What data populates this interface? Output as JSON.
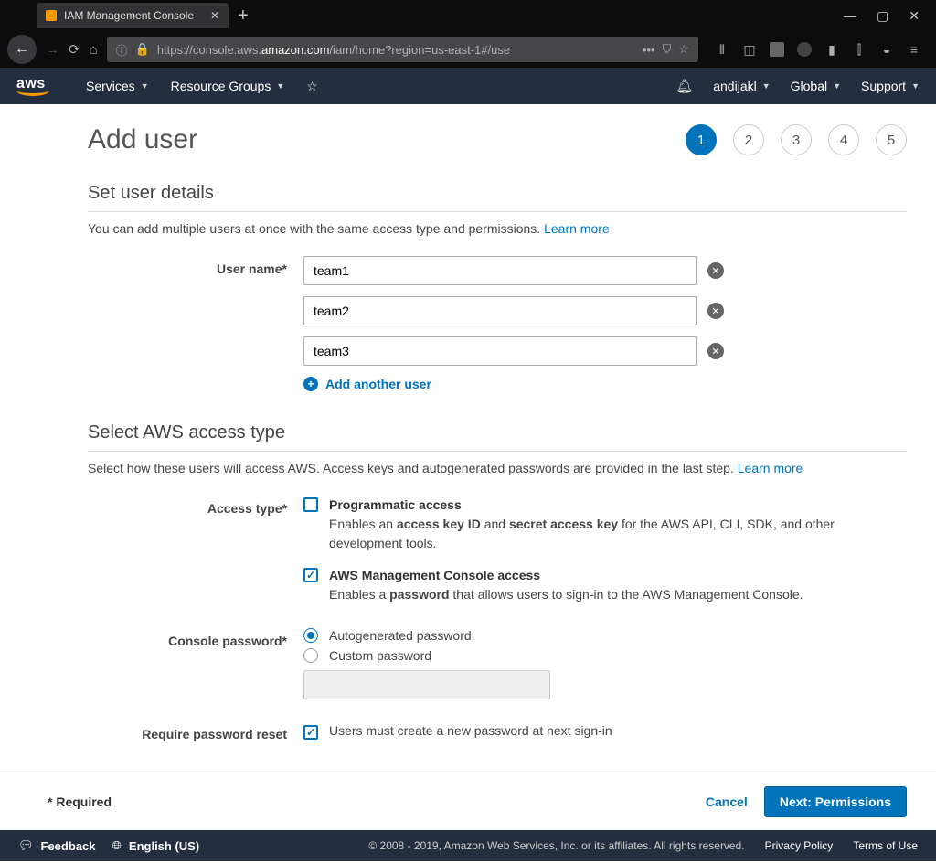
{
  "browser": {
    "tab_title": "IAM Management Console",
    "url_pre": "https://console.aws.",
    "url_dom": "amazon.com",
    "url_post": "/iam/home?region=us-east-1#/use"
  },
  "nav": {
    "logo": "aws",
    "services": "Services",
    "resource_groups": "Resource Groups",
    "user": "andijakl",
    "region": "Global",
    "support": "Support"
  },
  "page": {
    "title": "Add user",
    "steps": [
      "1",
      "2",
      "3",
      "4",
      "5"
    ],
    "active_step": 0
  },
  "details": {
    "heading": "Set user details",
    "desc": "You can add multiple users at once with the same access type and permissions. ",
    "learn": "Learn more",
    "username_label": "User name*",
    "users": [
      "team1",
      "team2",
      "team3"
    ],
    "add_another": "Add another user"
  },
  "access": {
    "heading": "Select AWS access type",
    "desc": "Select how these users will access AWS. Access keys and autogenerated passwords are provided in the last step. ",
    "learn": "Learn more",
    "type_label": "Access type*",
    "prog_title": "Programmatic access",
    "prog_pre": "Enables an ",
    "prog_b1": "access key ID",
    "prog_mid": " and ",
    "prog_b2": "secret access key",
    "prog_post": " for the AWS API, CLI, SDK, and other development tools.",
    "cons_title": "AWS Management Console access",
    "cons_pre": "Enables a ",
    "cons_b": "password",
    "cons_post": " that allows users to sign-in to the AWS Management Console.",
    "pwd_label": "Console password*",
    "pwd_auto": "Autogenerated password",
    "pwd_custom": "Custom password",
    "reset_label": "Require password reset",
    "reset_text": "Users must create a new password at next sign-in"
  },
  "actions": {
    "required": "* Required",
    "cancel": "Cancel",
    "next": "Next: Permissions"
  },
  "footer": {
    "feedback": "Feedback",
    "lang": "English (US)",
    "copyright": "© 2008 - 2019, Amazon Web Services, Inc. or its affiliates. All rights reserved.",
    "privacy": "Privacy Policy",
    "terms": "Terms of Use"
  }
}
